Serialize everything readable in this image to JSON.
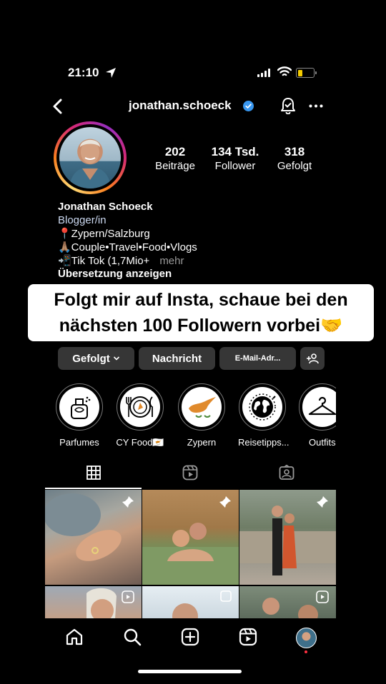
{
  "status": {
    "time": "21:10"
  },
  "header": {
    "username": "jonathan.schoeck"
  },
  "stats": [
    {
      "value": "202",
      "label": "Beiträge"
    },
    {
      "value": "134 Tsd.",
      "label": "Follower"
    },
    {
      "value": "318",
      "label": "Gefolgt"
    }
  ],
  "bio": {
    "name": "Jonathan Schoeck",
    "category": "Blogger/in",
    "line1": "📍Zypern/Salzburg",
    "line2": "🙏🏽Couple•Travel•Food•Vlogs",
    "line3": "📲Tik Tok (1,7Mio+",
    "more": "mehr",
    "translate": "Übersetzung anzeigen"
  },
  "caption": {
    "line1": "Folgt mir auf Insta, schaue bei den",
    "line2": "nächsten 100 Followern vorbei🤝"
  },
  "buttons": {
    "following": "Gefolgt",
    "message": "Nachricht",
    "email": "E-Mail-Adr..."
  },
  "highlights": [
    {
      "label": "Parfumes",
      "icon": "perfume-icon"
    },
    {
      "label": "CY Food🇨🇾",
      "icon": "plate-icon"
    },
    {
      "label": "Zypern",
      "icon": "cyprus-map-icon"
    },
    {
      "label": "Reisetipps...",
      "icon": "globe-icon"
    },
    {
      "label": "Outfits",
      "icon": "hanger-icon"
    }
  ],
  "tabs": [
    "grid-icon",
    "reels-icon",
    "tagged-icon"
  ],
  "nav": [
    "home-icon",
    "search-icon",
    "create-icon",
    "reels-icon",
    "profile-icon"
  ],
  "colors": {
    "verified": "#3897f0",
    "battery": "#f5cc00",
    "button_bg": "#363636"
  }
}
